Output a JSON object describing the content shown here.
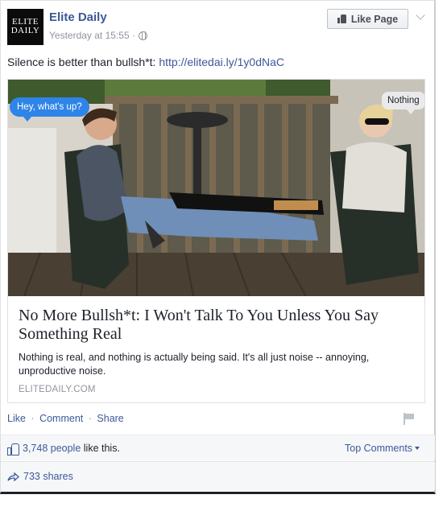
{
  "post": {
    "page_name": "Elite Daily",
    "logo_line1": "ELITE",
    "logo_line2": "DAILY",
    "timestamp": "Yesterday at 15:55 ·",
    "like_page_label": "Like Page",
    "status_text": "Silence is better than bullsh*t: ",
    "status_link": "http://elitedai.ly/1y0dNaC"
  },
  "link_preview": {
    "bubble_left": "Hey, what's up?",
    "bubble_right": "Nothing",
    "title": "No More Bullsh*t: I Won't Talk To You Unless You Say Something Real",
    "description": "Nothing is real, and nothing is actually being said. It's all just noise -- annoying, unproductive noise.",
    "domain": "ELITEDAILY.COM"
  },
  "actions": {
    "like": "Like",
    "comment": "Comment",
    "share": "Share",
    "separator": "·"
  },
  "stats": {
    "likes_count": "3,748 people",
    "likes_suffix": " like this.",
    "top_comments": "Top Comments",
    "shares": "733 shares"
  },
  "colors": {
    "link_blue": "#3b5998",
    "bubble_blue": "#2f84e8",
    "meta_gray": "#90949c"
  }
}
